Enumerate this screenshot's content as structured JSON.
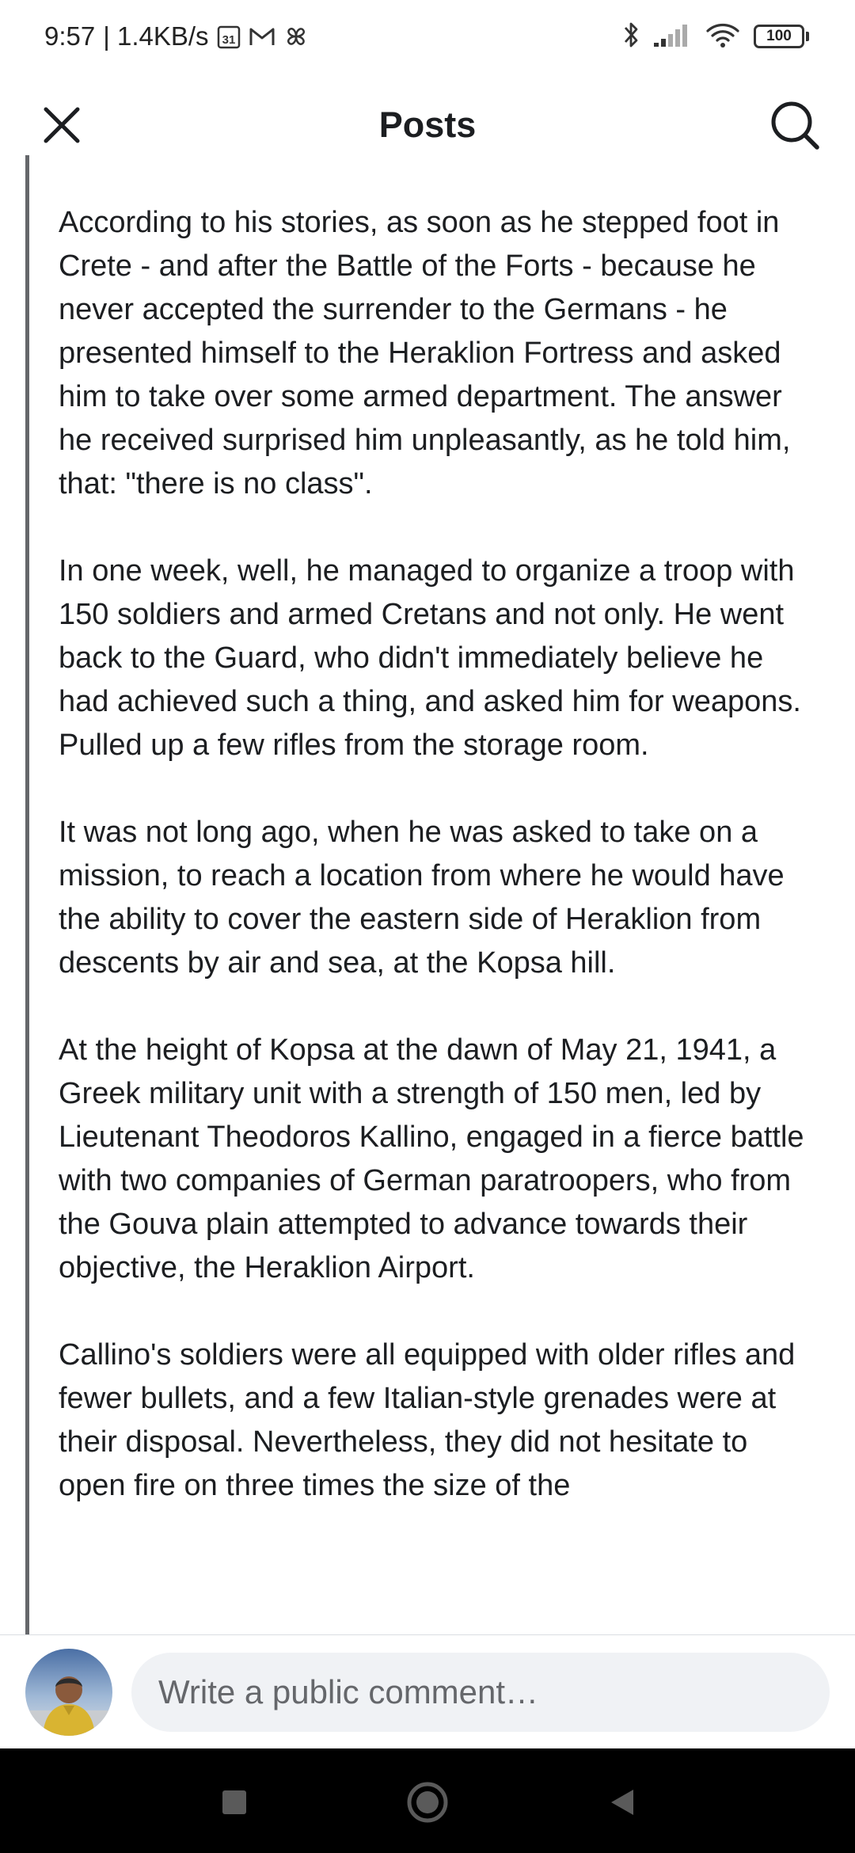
{
  "status_bar": {
    "time": "9:57",
    "speed": "| 1.4KB/s",
    "calendar_day": "31",
    "battery": "100"
  },
  "header": {
    "title": "Posts"
  },
  "post": {
    "paragraphs": [
      "According to his stories, as soon as he stepped foot in Crete - and after the Battle of the Forts - because he never accepted the surrender to the Germans - he presented himself to the Heraklion Fortress and asked him to take over some armed department. The answer he received surprised him unpleasantly, as he told him, that: \"there is no class\".",
      "In one week, well, he managed to organize a troop with 150 soldiers and armed Cretans and not only. He went back to the Guard, who didn't immediately believe he had achieved such a thing, and asked him for weapons. Pulled up a few rifles from the storage room.",
      "It was not long ago, when he was asked to take on a mission, to reach a location from where he would have the ability to cover the eastern side of Heraklion from descents by air and sea, at the Kopsa hill.",
      "At the height of Kopsa at the dawn of May 21, 1941, a Greek military unit with a strength of 150 men, led by Lieutenant Theodoros Kallino, engaged in a fierce battle with two companies of German paratroopers, who from the Gouva plain attempted to advance towards their objective, the Heraklion Airport.",
      "Callino's soldiers were all equipped with older rifles and fewer bullets, and a few Italian-style grenades were at their disposal. Nevertheless, they did not hesitate to open fire on three times the size of the"
    ]
  },
  "comment": {
    "placeholder": "Write a public comment…"
  },
  "colors": {
    "text": "#1c1e21",
    "muted": "#65676b",
    "input_bg": "#f0f2f5",
    "nav_bg": "#000000"
  }
}
